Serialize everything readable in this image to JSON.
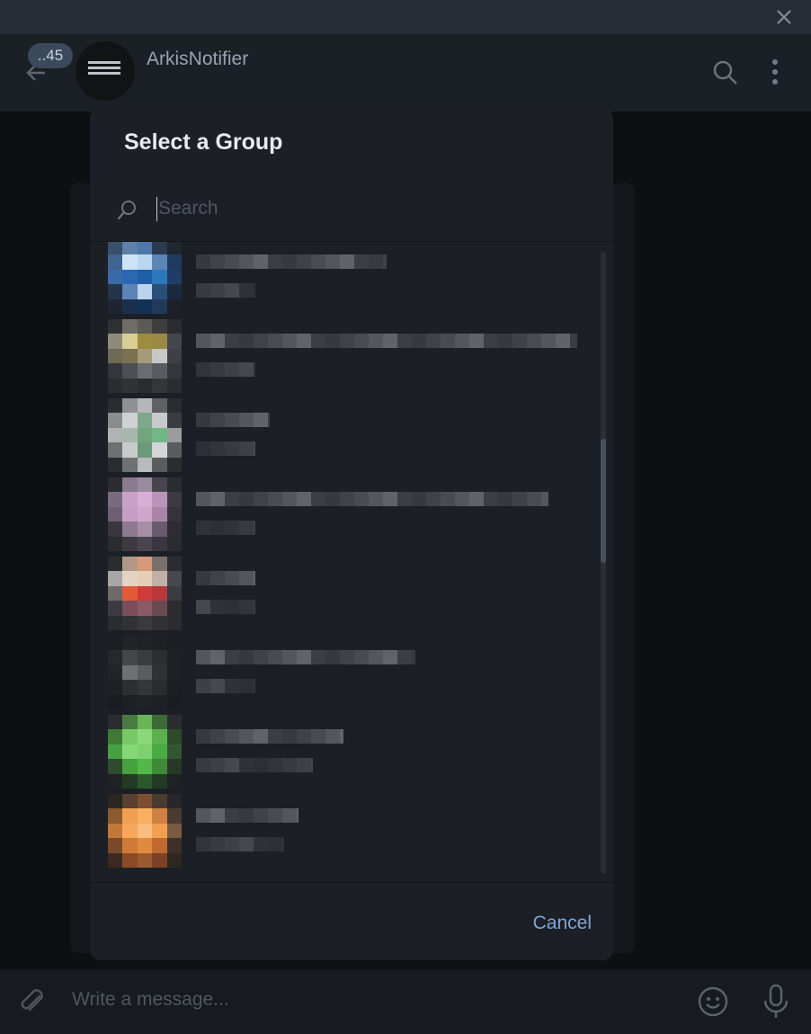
{
  "window": {
    "close_icon": "close-icon"
  },
  "chat_header": {
    "unread_count": "..45",
    "peer_name": "ArkisNotifier"
  },
  "composer": {
    "placeholder": "Write a message..."
  },
  "dialog": {
    "title": "Select a Group",
    "search_placeholder": "Search",
    "cancel_label": "Cancel",
    "groups": [
      {
        "avatar": [
          "#3a4f6a",
          "#5d7fa8",
          "#4f77a8",
          "#2a3a50",
          "#1f2730",
          "#40648f",
          "#cfe3f6",
          "#bcd6ef",
          "#5a86b8",
          "#1f3a5e",
          "#3b6aa8",
          "#2a68b3",
          "#1f5fa8",
          "#2d78b8",
          "#1f3d66",
          "#25344a",
          "#5d84b8",
          "#bcd3ee",
          "#2a4f7a",
          "#1a2a3e",
          "#1e2430",
          "#1b2f4d",
          "#123156",
          "#223a5a",
          "#1c2028"
        ],
        "line_widths": [
          212
        ],
        "sub_widths": [
          66
        ]
      },
      {
        "avatar": [
          "#2e3034",
          "#6e6c66",
          "#5c5a56",
          "#3e3e3e",
          "#2a2c30",
          "#8e8a7a",
          "#d9cf94",
          "#9d8b3f",
          "#9a8a44",
          "#43464c",
          "#6e6a56",
          "#7a7150",
          "#a59b7a",
          "#c8c8c8",
          "#3e4046",
          "#34363c",
          "#4d4f55",
          "#6a6c72",
          "#5a5c62",
          "#34363c",
          "#2a2c30",
          "#303238",
          "#2a2c30",
          "#34363c",
          "#2a2c30"
        ],
        "line_widths": [
          424
        ],
        "sub_widths": [
          66
        ]
      },
      {
        "avatar": [
          "#2a2c30",
          "#8e9092",
          "#b4b6b8",
          "#5e6062",
          "#2a2c30",
          "#8a8c8e",
          "#cfd1d3",
          "#7da88a",
          "#c8cacc",
          "#3a3c40",
          "#b0b2b4",
          "#a8b7ac",
          "#72a47e",
          "#6fb886",
          "#9a9c9e",
          "#6e7072",
          "#c8cacc",
          "#6a9a78",
          "#d2d4d6",
          "#5a5c5e",
          "#2a2c30",
          "#6e7072",
          "#b8babc",
          "#5a5c5e",
          "#2a2c30"
        ],
        "line_widths": [
          82
        ],
        "sub_widths": [
          66
        ]
      },
      {
        "avatar": [
          "#2a2c30",
          "#8a7a8e",
          "#9a8aa0",
          "#4a4450",
          "#2a2c30",
          "#7a6a80",
          "#c9a1c7",
          "#d7aed5",
          "#b894b8",
          "#3e3a44",
          "#6e5e72",
          "#c79dc5",
          "#cfa6cd",
          "#a986a8",
          "#36333a",
          "#3a3640",
          "#8e7a90",
          "#a58ea6",
          "#6a5a6e",
          "#2e2c32",
          "#2a2c30",
          "#3e3a42",
          "#4a4450",
          "#3a3640",
          "#2a2c30"
        ],
        "line_widths": [
          392
        ],
        "sub_widths": [
          66
        ]
      },
      {
        "avatar": [
          "#2a2c30",
          "#b09884",
          "#d69a7a",
          "#7a6f6a",
          "#2a2c30",
          "#a8a6a4",
          "#e4d2c2",
          "#e6cdb5",
          "#c0b0a6",
          "#48484c",
          "#6e6a6a",
          "#e25a3a",
          "#cf3a3a",
          "#b8383c",
          "#3a3c40",
          "#3c3a3e",
          "#7a4e5a",
          "#8a5a66",
          "#6a4a52",
          "#2c2c30",
          "#2a2c30",
          "#323236",
          "#3a3a3e",
          "#323236",
          "#2a2c30"
        ],
        "line_widths": [
          66
        ],
        "sub_widths": [
          66
        ]
      },
      {
        "avatar": [
          "#1c1e22",
          "#222428",
          "#202226",
          "#1e2024",
          "#1c1e22",
          "#26282c",
          "#444648",
          "#3a3c3e",
          "#2c2e32",
          "#1e2024",
          "#222428",
          "#6e7072",
          "#5a5c5e",
          "#303234",
          "#1e2024",
          "#1e2024",
          "#2c2e30",
          "#343638",
          "#2a2c2e",
          "#1c1e22",
          "#1a1c20",
          "#1e2024",
          "#202226",
          "#1e2024",
          "#1a1c20"
        ],
        "line_widths": [
          244
        ],
        "sub_widths": [
          66
        ]
      },
      {
        "avatar": [
          "#2a2c30",
          "#4a7a42",
          "#6ab458",
          "#3e6a38",
          "#2a2c30",
          "#3e7a36",
          "#78c868",
          "#8ad879",
          "#5cb04e",
          "#2e4a2a",
          "#46a042",
          "#86d877",
          "#7ed06f",
          "#4aaa44",
          "#325632",
          "#2c4c2c",
          "#48a03e",
          "#52b84a",
          "#3e8a38",
          "#283828",
          "#1e2222",
          "#243a26",
          "#2a5a2c",
          "#243a26",
          "#1e2222"
        ],
        "line_widths": [
          164
        ],
        "sub_widths": [
          130
        ]
      },
      {
        "avatar": [
          "#2a2620",
          "#5a4030",
          "#7a5030",
          "#4a3a30",
          "#28262a",
          "#8a5a30",
          "#f0a050",
          "#f8b060",
          "#d08040",
          "#4a3a30",
          "#c27838",
          "#f6a85a",
          "#fbbc80",
          "#f2a050",
          "#7a5a40",
          "#7a4a2a",
          "#d07a3a",
          "#e08a40",
          "#c06a30",
          "#3e3028",
          "#3a2a22",
          "#8a4a28",
          "#9a5a30",
          "#7a4028",
          "#2e2620"
        ],
        "line_widths": [
          114
        ],
        "sub_widths": [
          98
        ]
      }
    ]
  },
  "icons": {
    "back": "back-arrow-icon",
    "search": "search-icon",
    "more": "more-vertical-icon",
    "attach": "paperclip-icon",
    "emoji": "emoji-icon",
    "mic": "microphone-icon"
  }
}
